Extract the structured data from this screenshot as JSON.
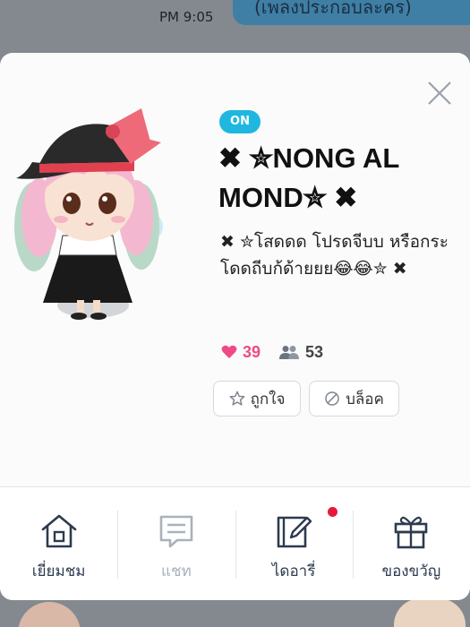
{
  "background": {
    "chat_bubble_text": "(เพลงประกอบละคร)",
    "chat_time": "PM 9:05"
  },
  "profile": {
    "status_badge": "ON",
    "name": "✖ ✮NONG AL MOND✮ ✖",
    "status_message": "✖ ✮โสดดด โปรดจีบบ หรือกระโดดถีบก้ด้ายยย😂😂✮ ✖",
    "likes": "39",
    "friends": "53"
  },
  "actions": {
    "like_label": "ถูกใจ",
    "block_label": "บล็อค"
  },
  "nav": {
    "items": [
      {
        "label": "เยี่ยมชม",
        "icon": "home-icon",
        "enabled": true
      },
      {
        "label": "แชท",
        "icon": "chat-icon",
        "enabled": false
      },
      {
        "label": "ไดอารี่",
        "icon": "diary-icon",
        "enabled": true,
        "has_new": true
      },
      {
        "label": "ของขวัญ",
        "icon": "gift-icon",
        "enabled": true
      }
    ]
  },
  "colors": {
    "accent_badge": "#1fb7e0",
    "like_pink": "#f04a86",
    "new_dot": "#e8183a",
    "nav_text": "#2d3b4f",
    "nav_text_disabled": "#a8b1bd"
  }
}
